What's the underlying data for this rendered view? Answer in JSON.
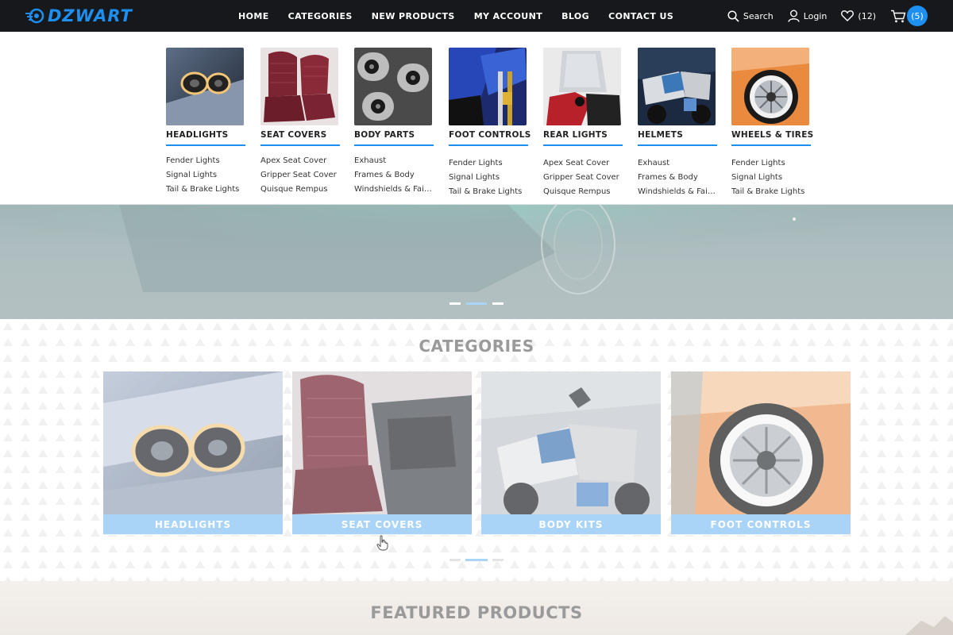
{
  "brand": {
    "name": "DZWART",
    "accent": "#1d8ff0"
  },
  "nav": {
    "items": [
      "HOME",
      "CATEGORIES",
      "NEW PRODUCTS",
      "MY ACCOUNT",
      "BLOG",
      "CONTACT US"
    ]
  },
  "tools": {
    "search_label": "Search",
    "login_label": "Login",
    "wishlist_count": "(12)",
    "cart_count": "(5)"
  },
  "mega_menu": {
    "columns": [
      {
        "title": "HEADLIGHTS",
        "links": [
          "Fender Lights",
          "Signal Lights",
          "Tail & Brake Lights"
        ],
        "image": "headlight-photo"
      },
      {
        "title": "SEAT COVERS",
        "links": [
          "Apex Seat Cover",
          "Gripper Seat Cover",
          "Quisque Rempus"
        ],
        "image": "seat-cover-photo"
      },
      {
        "title": "BODY PARTS",
        "links": [
          "Exhaust",
          "Frames & Body",
          "Windshields & Fairings"
        ],
        "image": "exhaust-photo"
      },
      {
        "title": "FOOT CONTROLS",
        "links": [
          "Fender Lights",
          "Signal Lights",
          "Tail & Brake Lights"
        ],
        "image": "motorbike-fork-photo"
      },
      {
        "title": "REAR LIGHTS",
        "links": [
          "Apex Seat Cover",
          "Gripper Seat Cover",
          "Quisque Rempus"
        ],
        "image": "windshield-photo"
      },
      {
        "title": "HELMETS",
        "links": [
          "Exhaust",
          "Frames & Body",
          "Windshields & Fairings"
        ],
        "image": "motorbike-photo"
      },
      {
        "title": "WHEELS & TIRES",
        "links": [
          "Fender Lights",
          "Signal Lights",
          "Tail & Brake Lights"
        ],
        "image": "wheel-photo"
      }
    ]
  },
  "hero": {
    "slide_count": 3,
    "active_slide": 2
  },
  "categories": {
    "title": "CATEGORIES",
    "cards": [
      {
        "label": "HEADLIGHTS",
        "image": "headlight-photo"
      },
      {
        "label": "SEAT COVERS",
        "image": "seat-cover-photo"
      },
      {
        "label": "BODY KITS",
        "image": "motorbike-photo"
      },
      {
        "label": "FOOT CONTROLS",
        "image": "wheel-photo"
      }
    ],
    "active_page": 2,
    "page_count": 3
  },
  "featured": {
    "title": "FEATURED PRODUCTS"
  },
  "colors": {
    "topbar": "#16181c",
    "label_bg": "#a9d3f7",
    "section_title": "#9a9a9a"
  }
}
